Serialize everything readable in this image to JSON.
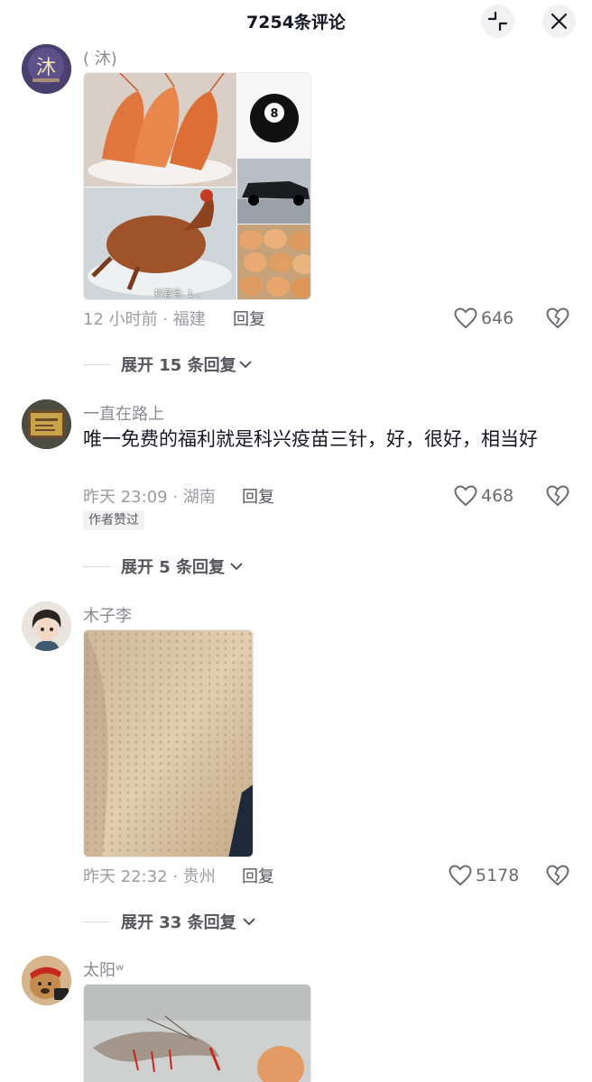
{
  "header": {
    "title": "7254条评论"
  },
  "comments": [
    {
      "username": "( 沐)",
      "avatar_icon": "mu-avatar",
      "time_location": "12 小时前 · 福建",
      "reply_label": "回复",
      "likes": "646",
      "expand_label": "展开 15 条回复",
      "images": [
        "shrimp-photo",
        "roast-chicken-photo",
        "billiard-8-ball-photo",
        "black-suv-photo",
        "eggs-photo"
      ],
      "watermark": "抖音号: 1…"
    },
    {
      "username": "一直在路上",
      "avatar_icon": "plaque-avatar",
      "text": "唯一免费的福利就是科兴疫苗三针，好，很好，相当好",
      "time_location": "昨天 23:09 · 湖南",
      "reply_label": "回复",
      "likes": "468",
      "badge": "作者赞过",
      "expand_label": "展开 5 条回复"
    },
    {
      "username": "木子李",
      "avatar_icon": "cartoon-boy-avatar",
      "time_location": "昨天 22:32 · 贵州",
      "reply_label": "回复",
      "likes": "5178",
      "expand_label": "展开 33 条回复",
      "images": [
        "goosebumps-arm-photo"
      ]
    },
    {
      "username": "太阳ʷ",
      "avatar_icon": "dog-avatar",
      "images": [
        "shrimp-and-egg-photo"
      ]
    }
  ],
  "colors": {
    "text": "#161823",
    "secondary": "#9b9ca1",
    "link": "#55565c"
  }
}
